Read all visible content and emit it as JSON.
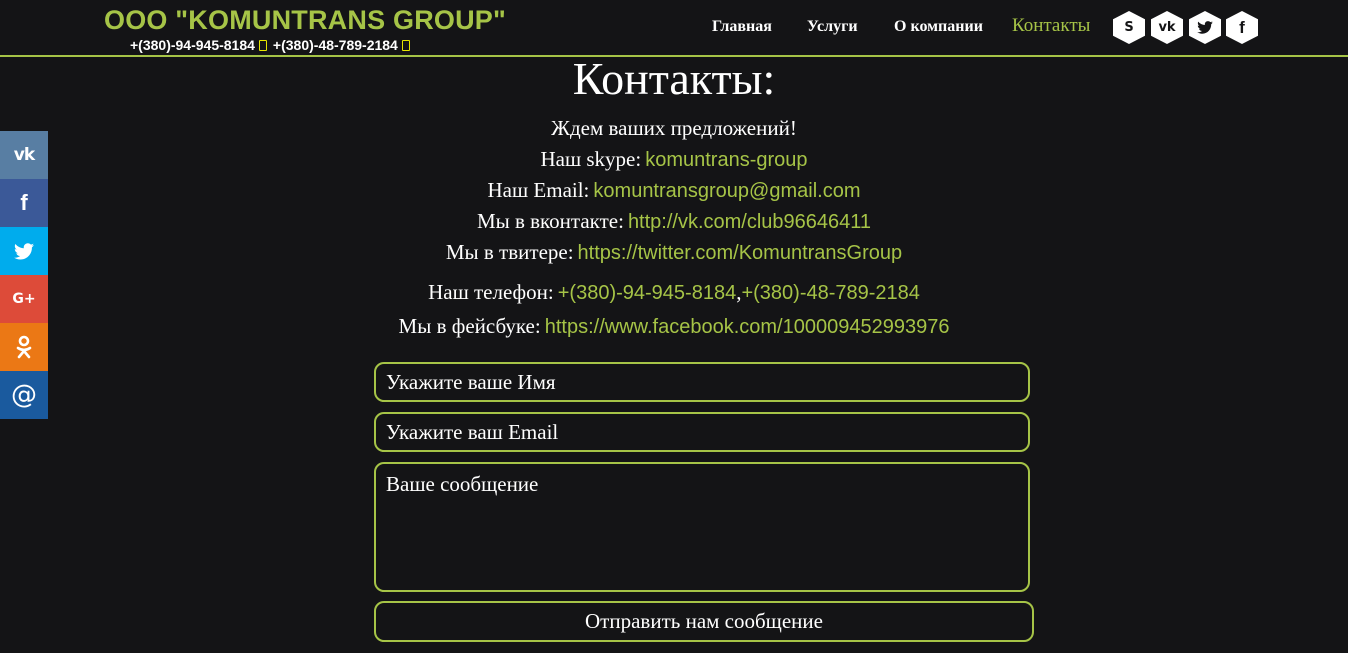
{
  "header": {
    "brand": "ООО \"KOMUNTRANS GROUP\"",
    "phone1": "+(380)-94-945-8184",
    "phone2": "+(380)-48-789-2184",
    "nav": [
      {
        "label": "Главная"
      },
      {
        "label": "Услуги"
      },
      {
        "label": "О компании"
      },
      {
        "label": "Контакты",
        "active": true
      }
    ],
    "social_icons": [
      "skype-icon",
      "vk-icon",
      "twitter-icon",
      "facebook-icon"
    ]
  },
  "share_bar": [
    {
      "icon": "vk-icon",
      "glyph": "vk",
      "color": "#587ea3"
    },
    {
      "icon": "facebook-icon",
      "glyph": "f",
      "color": "#3b5998"
    },
    {
      "icon": "twitter-icon",
      "glyph": "t",
      "color": "#00aced"
    },
    {
      "icon": "google-plus-icon",
      "glyph": "G+",
      "color": "#dd4b39"
    },
    {
      "icon": "odnoklassniki-icon",
      "glyph": "ok",
      "color": "#eb7815"
    },
    {
      "icon": "email-icon",
      "glyph": "@",
      "color": "#1a5a9e"
    }
  ],
  "contacts": {
    "title": "Контакты:",
    "intro": "Ждем ваших предложений!",
    "skype_label": "Наш skype:",
    "skype_value": "komuntrans-group",
    "email_label": "Наш Email:",
    "email_value": "komuntransgroup@gmail.com",
    "vk_label": "Мы в вконтакте:",
    "vk_value": "http://vk.com/club96646411",
    "twitter_label": "Мы в твитере:",
    "twitter_value": "https://twitter.com/KomuntransGroup",
    "phone_label": "Наш телефон:",
    "phone_value1": "+(380)-94-945-8184",
    "phone_sep": ",",
    "phone_value2": "+(380)-48-789-2184",
    "facebook_label": "Мы в фейсбуке:",
    "facebook_value": "https://www.facebook.com/100009452993976"
  },
  "form": {
    "name_placeholder": "Укажите ваше Имя",
    "email_placeholder": "Укажите ваш Email",
    "message_placeholder": "Ваше сообщение",
    "submit_label": "Отправить нам сообщение"
  },
  "colors": {
    "accent": "#a6c447",
    "background": "#141416",
    "text": "#ffffff"
  }
}
